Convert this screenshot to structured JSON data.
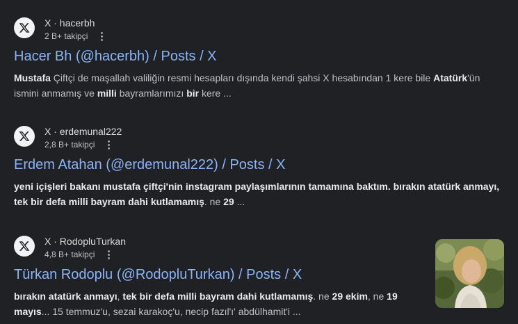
{
  "results": [
    {
      "site": "X",
      "separator": " · ",
      "handle": "hacerbh",
      "followers": "2 B+ takipçi",
      "title": "Hacer Bh (@hacerbh) / Posts / X",
      "snippet": [
        {
          "t": "Mustafa",
          "b": true
        },
        {
          "t": " Çiftçi de maşallah valiliğin resmi hesapları dışında kendi şahsi X hesabından 1 kere bile ",
          "b": false
        },
        {
          "t": "Atatürk",
          "b": true
        },
        {
          "t": "'ün ismini anmamış ve ",
          "b": false
        },
        {
          "t": "milli",
          "b": true
        },
        {
          "t": " bayramlarımızı ",
          "b": false
        },
        {
          "t": "bir",
          "b": true
        },
        {
          "t": " kere ...",
          "b": false
        }
      ]
    },
    {
      "site": "X",
      "separator": " · ",
      "handle": "erdemunal222",
      "followers": "2,8 B+ takipçi",
      "title": "Erdem Atahan (@erdemunal222) / Posts / X",
      "snippet": [
        {
          "t": "yeni içişleri bakanı mustafa çiftçi'nin instagram paylaşımlarının tamamına baktım. bırakın atatürk anmayı, tek bir defa milli bayram dahi kutlamamış",
          "b": true
        },
        {
          "t": ". ne ",
          "b": false
        },
        {
          "t": "29",
          "b": true
        },
        {
          "t": " ...",
          "b": false
        }
      ]
    },
    {
      "site": "X",
      "separator": " · ",
      "handle": "RodopluTurkan",
      "followers": "4,8 B+ takipçi",
      "title": "Türkan Rodoplu (@RodopluTurkan) / Posts / X",
      "snippet": [
        {
          "t": "bırakın atatürk anmayı",
          "b": true
        },
        {
          "t": ", ",
          "b": false
        },
        {
          "t": "tek bir defa milli bayram dahi kutlamamış",
          "b": true
        },
        {
          "t": ". ne ",
          "b": false
        },
        {
          "t": "29 ekim",
          "b": true
        },
        {
          "t": ", ne ",
          "b": false
        },
        {
          "t": "19 mayıs",
          "b": true
        },
        {
          "t": "... 15 temmuz'u, sezai karakoç'u, necip fazıl'ı' abdülhamit'i ...",
          "b": false
        }
      ]
    }
  ],
  "icons": {
    "favicon": "x-logo-icon",
    "menu": "more-vert-icon"
  }
}
